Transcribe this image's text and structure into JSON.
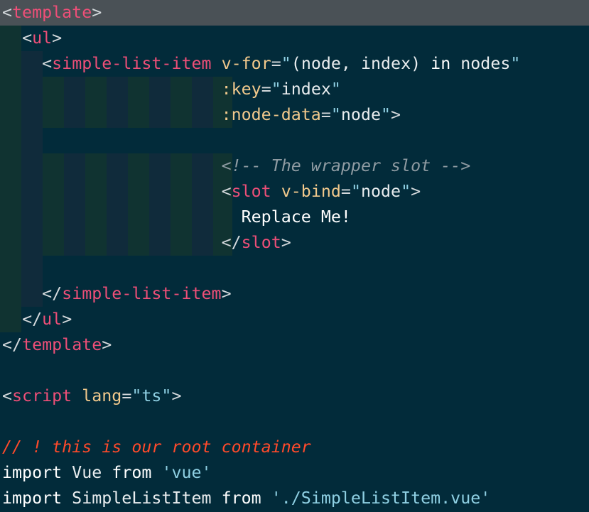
{
  "editor": {
    "background": "#022b3a",
    "highlight_line_background": "#4a5156",
    "colors": {
      "punct": "#d4d9dc",
      "tag": "#ee4f78",
      "attr": "#f2c98c",
      "string": "#8fd0e3",
      "comment": "#8f9ba2",
      "comment_alt": "#ff4a2b",
      "text": "#ffffff"
    },
    "lines": [
      {
        "highlight": true,
        "tokens": [
          [
            "punct",
            "<"
          ],
          [
            "tag",
            "template"
          ],
          [
            "punct",
            ">"
          ]
        ]
      },
      {
        "tokens": [
          [
            "plain",
            "  "
          ],
          [
            "punct",
            "<"
          ],
          [
            "tag",
            "ul"
          ],
          [
            "punct",
            ">"
          ]
        ]
      },
      {
        "tokens": [
          [
            "plain",
            "    "
          ],
          [
            "punct",
            "<"
          ],
          [
            "tag",
            "simple-list-item"
          ],
          [
            "plain",
            " "
          ],
          [
            "attr",
            "v-for"
          ],
          [
            "punct",
            "="
          ],
          [
            "string",
            "\""
          ],
          [
            "plain",
            "(node, index) "
          ],
          [
            "keyword",
            "in"
          ],
          [
            "plain",
            " nodes"
          ],
          [
            "string",
            "\""
          ]
        ]
      },
      {
        "tokens": [
          [
            "plain",
            "                      "
          ],
          [
            "attr",
            ":key"
          ],
          [
            "punct",
            "="
          ],
          [
            "string",
            "\""
          ],
          [
            "plain",
            "index"
          ],
          [
            "string",
            "\""
          ]
        ]
      },
      {
        "tokens": [
          [
            "plain",
            "                      "
          ],
          [
            "attr",
            ":node-data"
          ],
          [
            "punct",
            "="
          ],
          [
            "string",
            "\""
          ],
          [
            "plain",
            "node"
          ],
          [
            "string",
            "\""
          ],
          [
            "punct",
            ">"
          ]
        ]
      },
      {
        "tokens": []
      },
      {
        "tokens": [
          [
            "plain",
            "                      "
          ],
          [
            "comment",
            "<!-- The wrapper slot -->"
          ]
        ]
      },
      {
        "tokens": [
          [
            "plain",
            "                      "
          ],
          [
            "punct",
            "<"
          ],
          [
            "tag",
            "slot"
          ],
          [
            "plain",
            " "
          ],
          [
            "attr",
            "v-bind"
          ],
          [
            "punct",
            "="
          ],
          [
            "string",
            "\""
          ],
          [
            "plain",
            "node"
          ],
          [
            "string",
            "\""
          ],
          [
            "punct",
            ">"
          ]
        ]
      },
      {
        "tokens": [
          [
            "plain",
            "                        "
          ],
          [
            "text",
            "Replace Me!"
          ]
        ]
      },
      {
        "tokens": [
          [
            "plain",
            "                      "
          ],
          [
            "punct",
            "</"
          ],
          [
            "tag",
            "slot"
          ],
          [
            "punct",
            ">"
          ]
        ]
      },
      {
        "tokens": []
      },
      {
        "tokens": [
          [
            "plain",
            "    "
          ],
          [
            "punct",
            "</"
          ],
          [
            "tag",
            "simple-list-item"
          ],
          [
            "punct",
            ">"
          ]
        ]
      },
      {
        "tokens": [
          [
            "plain",
            "  "
          ],
          [
            "punct",
            "</"
          ],
          [
            "tag",
            "ul"
          ],
          [
            "punct",
            ">"
          ]
        ]
      },
      {
        "tokens": [
          [
            "punct",
            "</"
          ],
          [
            "tag",
            "template"
          ],
          [
            "punct",
            ">"
          ]
        ]
      },
      {
        "tokens": []
      },
      {
        "tokens": [
          [
            "punct",
            "<"
          ],
          [
            "tag",
            "script"
          ],
          [
            "plain",
            " "
          ],
          [
            "attr",
            "lang"
          ],
          [
            "punct",
            "="
          ],
          [
            "string",
            "\"ts\""
          ],
          [
            "punct",
            ">"
          ]
        ]
      },
      {
        "tokens": []
      },
      {
        "tokens": [
          [
            "comment-alt",
            "// ! this is our root container"
          ]
        ]
      },
      {
        "tokens": [
          [
            "keyword",
            "import"
          ],
          [
            "plain",
            " Vue "
          ],
          [
            "keyword",
            "from"
          ],
          [
            "plain",
            " "
          ],
          [
            "string",
            "'vue'"
          ]
        ]
      },
      {
        "tokens": [
          [
            "keyword",
            "import"
          ],
          [
            "plain",
            " SimpleListItem "
          ],
          [
            "keyword",
            "from"
          ],
          [
            "plain",
            " "
          ],
          [
            "string",
            "'./SimpleListItem.vue'"
          ]
        ]
      }
    ]
  }
}
